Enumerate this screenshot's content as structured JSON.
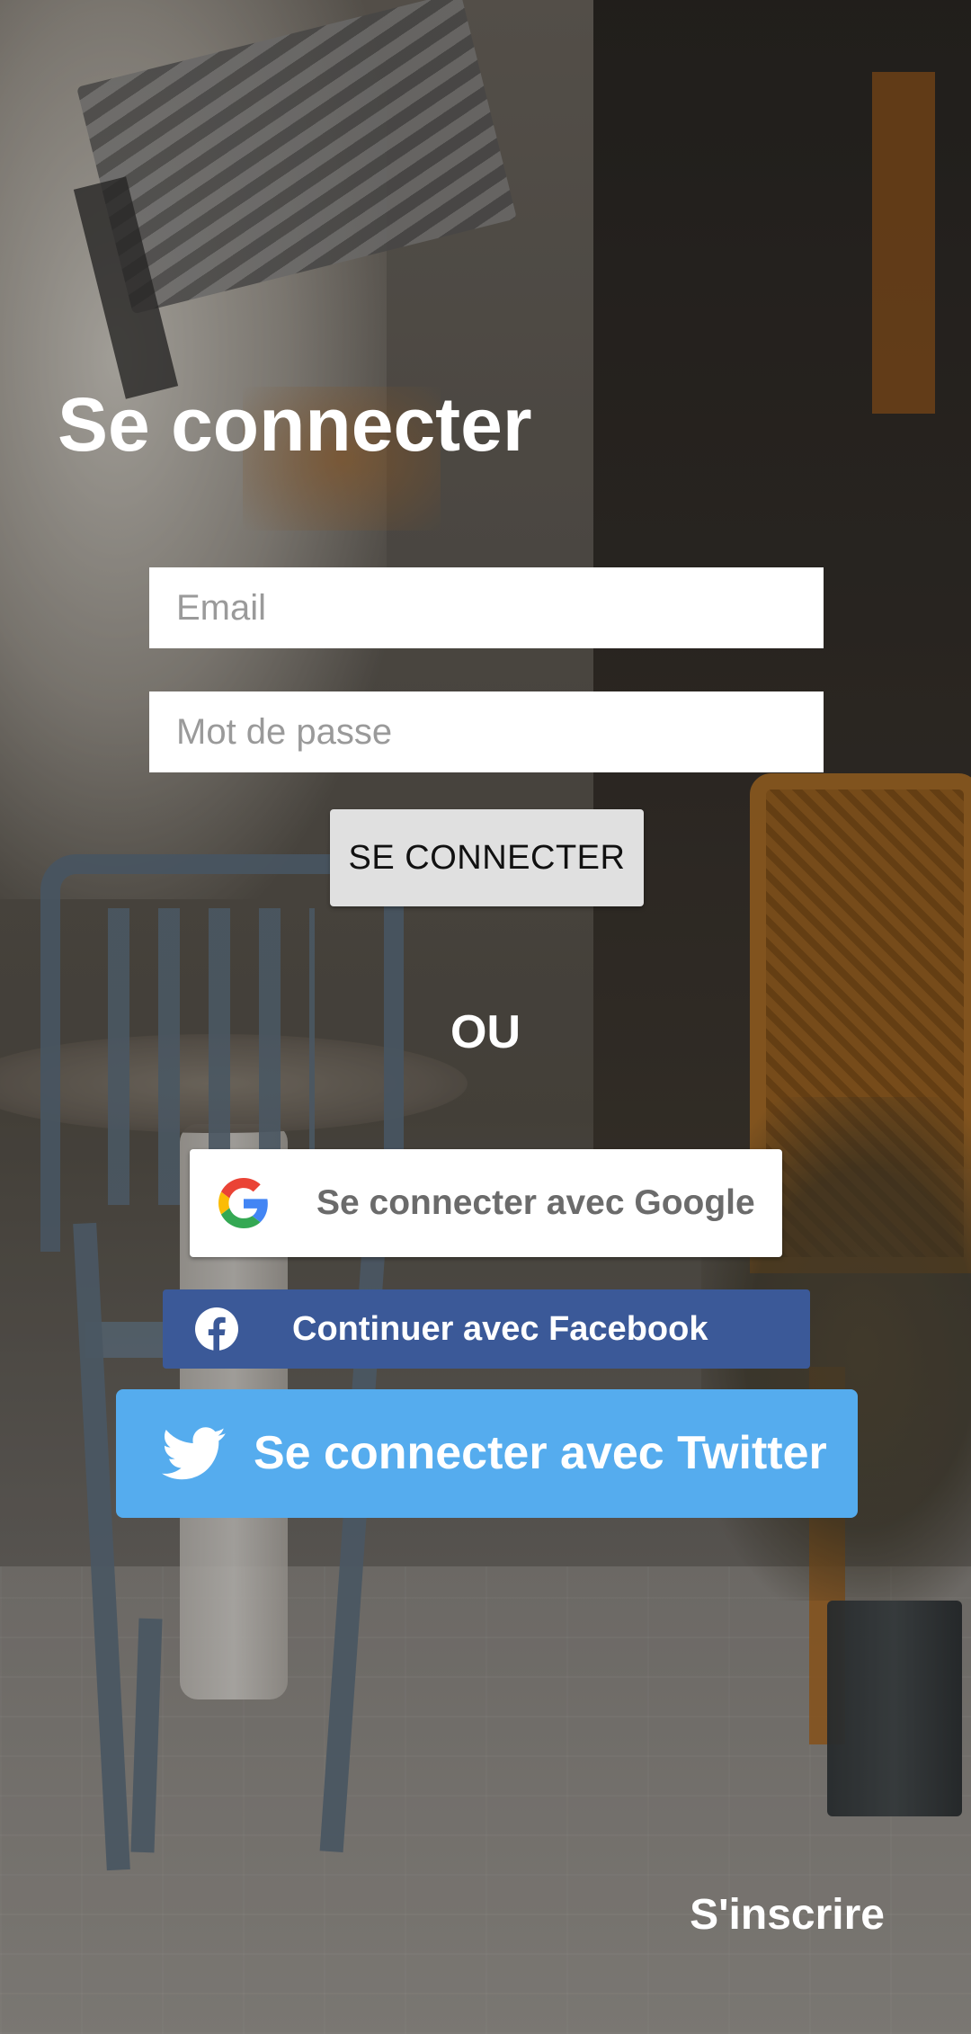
{
  "screen": {
    "title": "Se connecter"
  },
  "form": {
    "email": {
      "value": "",
      "placeholder": "Email"
    },
    "password": {
      "value": "",
      "placeholder": "Mot de passe"
    },
    "submit_label": "SE CONNECTER"
  },
  "divider": {
    "label": "OU"
  },
  "social": {
    "google": {
      "label": "Se connecter avec Google",
      "icon": "google-icon",
      "color": "#ffffff"
    },
    "facebook": {
      "label": "Continuer avec Facebook",
      "icon": "facebook-icon",
      "color": "#3b5998"
    },
    "twitter": {
      "label": "Se connecter avec Twitter",
      "icon": "twitter-icon",
      "color": "#55acee"
    }
  },
  "footer": {
    "signup_label": "S'inscrire"
  }
}
